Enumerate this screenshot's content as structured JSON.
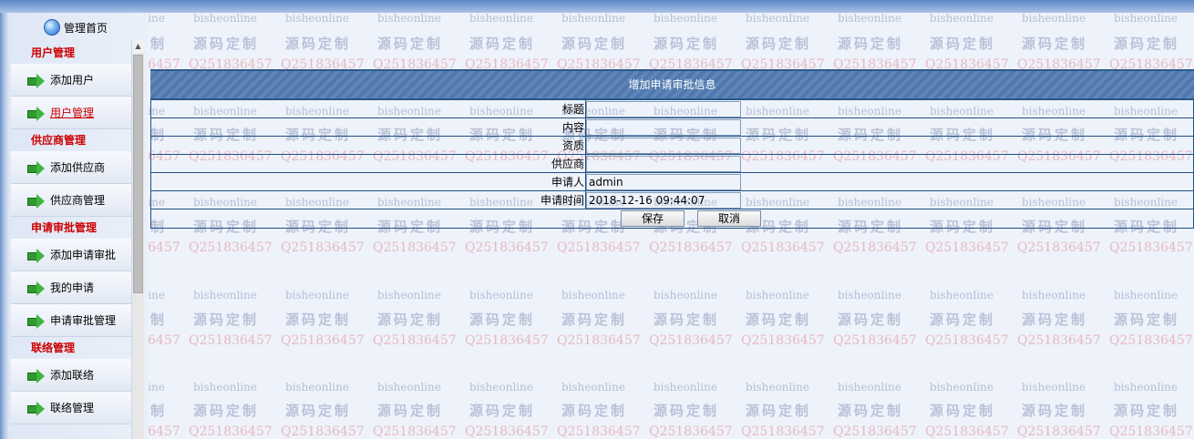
{
  "watermark": {
    "site": "bisheonline",
    "slogan": "源码定制",
    "qq": "Q251836457"
  },
  "sidebar": {
    "home_label": "管理首页",
    "groups": [
      {
        "title": "用户管理",
        "items": [
          {
            "label": "添加用户"
          },
          {
            "label": "用户管理",
            "active": true
          }
        ]
      },
      {
        "title": "供应商管理",
        "items": [
          {
            "label": "添加供应商"
          },
          {
            "label": "供应商管理"
          }
        ]
      },
      {
        "title": "申请审批管理",
        "items": [
          {
            "label": "添加申请审批"
          },
          {
            "label": "我的申请"
          },
          {
            "label": "申请审批管理"
          }
        ]
      },
      {
        "title": "联络管理",
        "items": [
          {
            "label": "添加联络"
          },
          {
            "label": "联络管理"
          }
        ]
      }
    ]
  },
  "form": {
    "title": "增加申请审批信息",
    "fields": [
      {
        "label": "标题",
        "value": ""
      },
      {
        "label": "内容",
        "value": ""
      },
      {
        "label": "资质",
        "value": ""
      },
      {
        "label": "供应商",
        "value": ""
      },
      {
        "label": "申请人",
        "value": "admin"
      },
      {
        "label": "申请时间",
        "value": "2018-12-16 09:44:07"
      }
    ],
    "save_label": "保存",
    "cancel_label": "取消"
  },
  "colors": {
    "header_bg": "#5e86b8",
    "group_title": "#cc0000",
    "table_border": "#1f4f85"
  }
}
